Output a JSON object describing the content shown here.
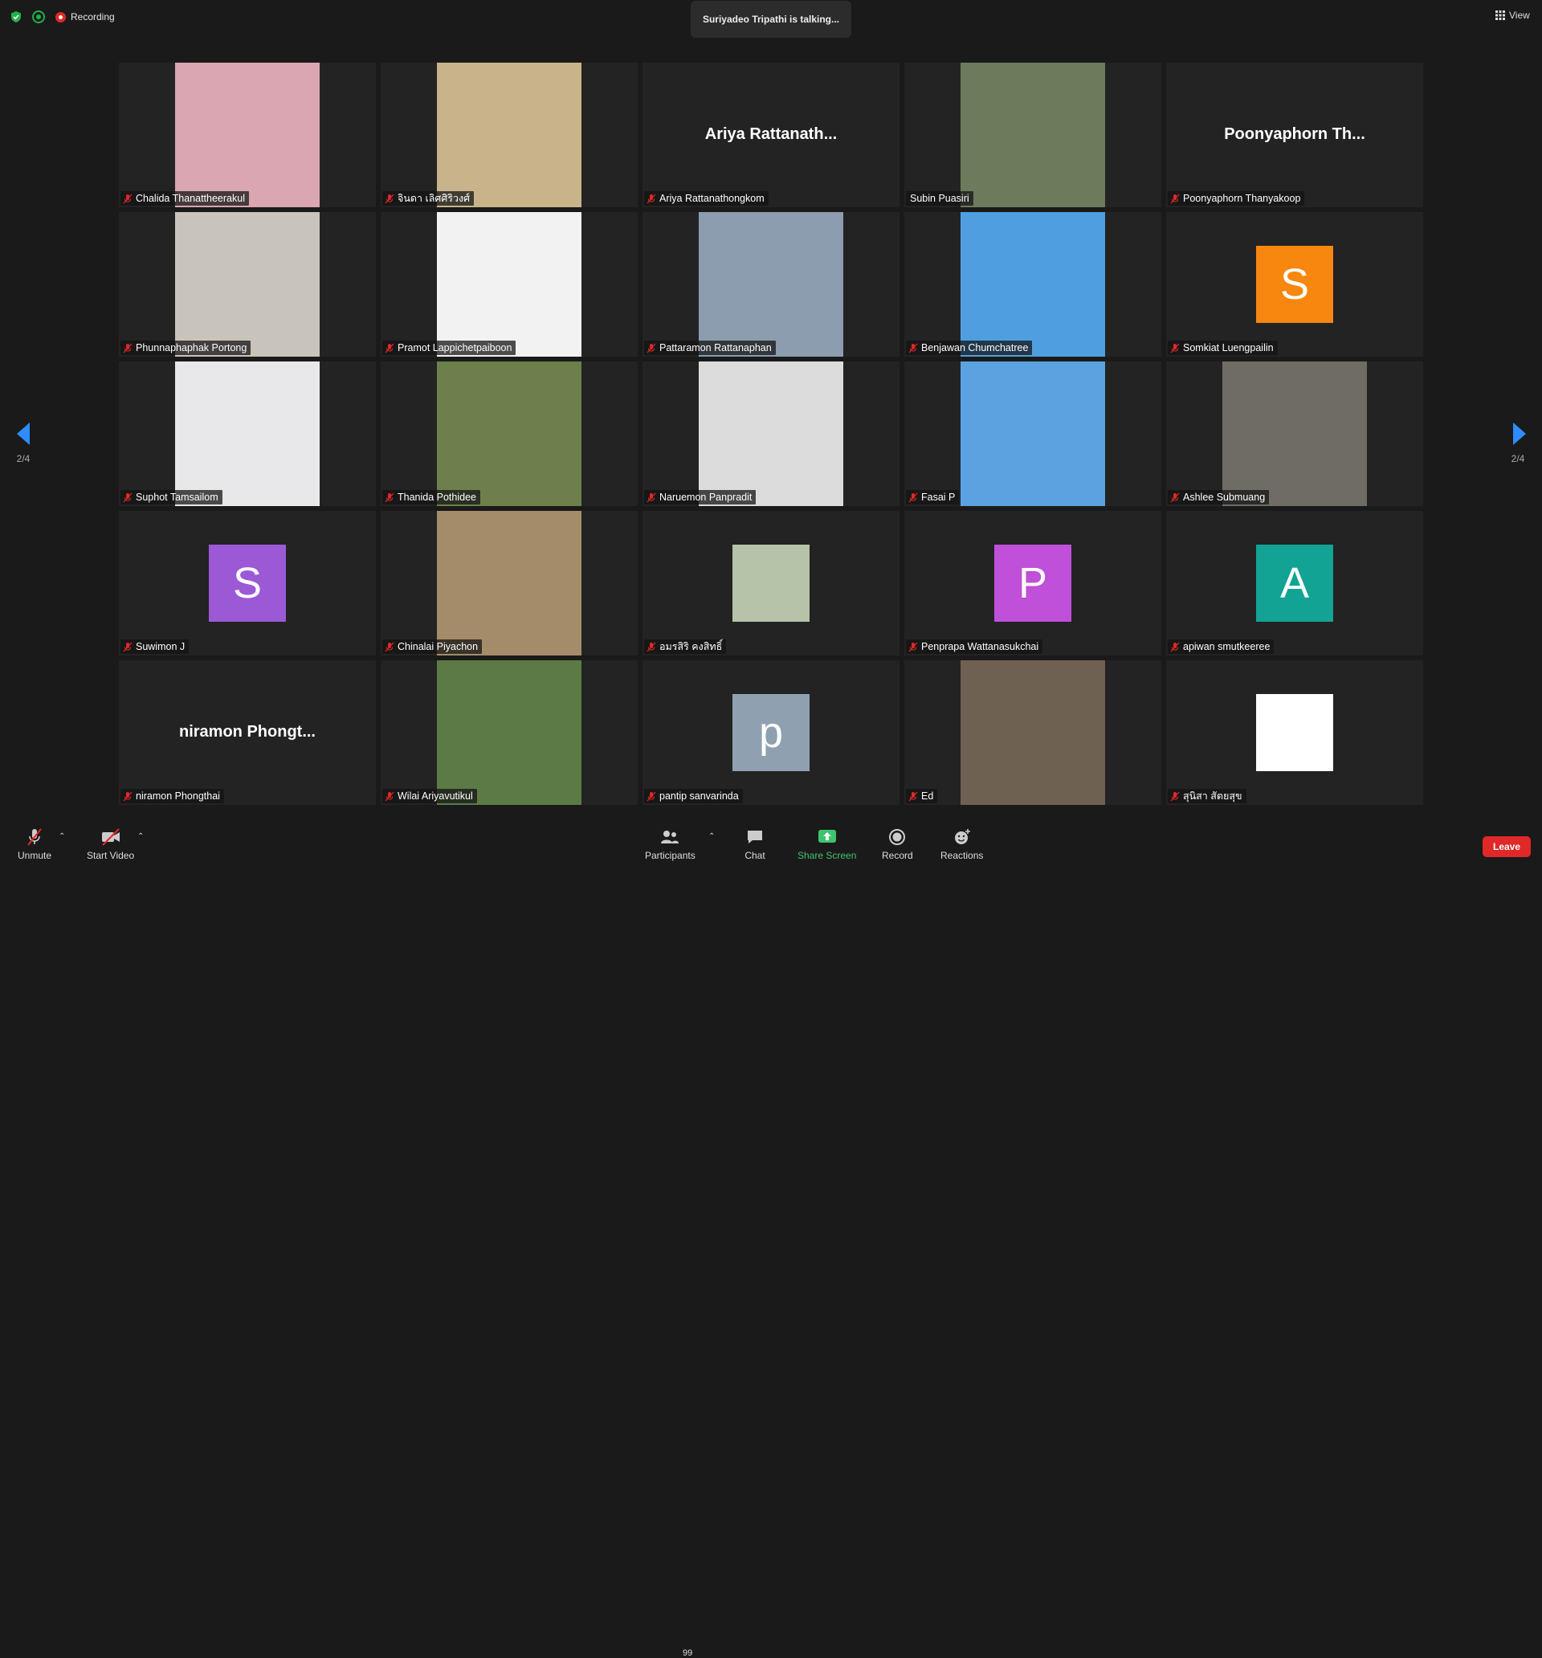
{
  "topbar": {
    "recording_label": "Recording",
    "talking": "Suriyadeo Tripathi is talking...",
    "view_label": "View"
  },
  "pagination": {
    "left": "2/4",
    "right": "2/4"
  },
  "participants": [
    {
      "name": "Chalida Thanattheerakul",
      "type": "photo",
      "color": "#d9a6b2",
      "muted": true
    },
    {
      "name": "จินดา เลิศศิริวงศ์",
      "type": "photo",
      "color": "#c8b48a",
      "muted": true
    },
    {
      "name": "Ariya Rattanathongkom",
      "type": "text",
      "display": "Ariya Rattanath...",
      "muted": true
    },
    {
      "name": "Subin Puasiri",
      "type": "photo",
      "color": "#6d7a5c",
      "muted": false
    },
    {
      "name": "Poonyaphorn Thanyakoop",
      "type": "text",
      "display": "Poonyaphorn Th...",
      "muted": true
    },
    {
      "name": "Phunnaphaphak Portong",
      "type": "photo",
      "color": "#c9c4bb",
      "muted": true
    },
    {
      "name": "Pramot Lappichetpaiboon",
      "type": "photo",
      "color": "#f2f2f2",
      "muted": true
    },
    {
      "name": "Pattaramon Rattanaphan",
      "type": "photo",
      "color": "#8d9db0",
      "muted": true
    },
    {
      "name": "Benjawan Chumchatree",
      "type": "photo",
      "color": "#4f9fe0",
      "muted": true
    },
    {
      "name": "Somkiat Luengpailin",
      "type": "letter",
      "letter": "S",
      "color": "#f7870f",
      "muted": true
    },
    {
      "name": "Suphot Tamsailom",
      "type": "photo",
      "color": "#e8e8ea",
      "muted": true
    },
    {
      "name": "Thanida Pothidee",
      "type": "photo",
      "color": "#6d7f4a",
      "muted": true
    },
    {
      "name": "Naruemon Panpradit",
      "type": "photo",
      "color": "#dcdcdc",
      "muted": true
    },
    {
      "name": "Fasai P",
      "type": "photo",
      "color": "#5aa2e0",
      "muted": true
    },
    {
      "name": "Ashlee Submuang",
      "type": "photo",
      "color": "#6f6d63",
      "muted": true
    },
    {
      "name": "Suwimon J",
      "type": "letter",
      "letter": "S",
      "color": "#9b59d6",
      "muted": true
    },
    {
      "name": "Chinalai Piyachon",
      "type": "photo",
      "color": "#a48c6a",
      "muted": true
    },
    {
      "name": "อมรสิริ คงสิทธิ์",
      "type": "photo-small",
      "color": "#b7c3a8",
      "muted": true
    },
    {
      "name": "Penprapa Wattanasukchai",
      "type": "letter",
      "letter": "P",
      "color": "#c04fd9",
      "muted": true
    },
    {
      "name": "apiwan smutkeeree",
      "type": "letter",
      "letter": "A",
      "color": "#12a395",
      "muted": true
    },
    {
      "name": "niramon Phongthai",
      "type": "text",
      "display": "niramon Phongt...",
      "muted": true
    },
    {
      "name": "Wilai Ariyavutikul",
      "type": "photo",
      "color": "#5c7a46",
      "muted": true
    },
    {
      "name": "pantip sanvarinda",
      "type": "letter",
      "letter": "p",
      "color": "#8fa1b0",
      "muted": true
    },
    {
      "name": "Ed",
      "type": "photo",
      "color": "#6e6152",
      "muted": true
    },
    {
      "name": "สุนิสา สัตยสุข",
      "type": "letter",
      "letter": "",
      "color": "#ffffff",
      "muted": true
    }
  ],
  "toolbar": {
    "unmute": "Unmute",
    "start_video": "Start Video",
    "participants": "Participants",
    "participants_count": "99",
    "chat": "Chat",
    "share_screen": "Share Screen",
    "record": "Record",
    "reactions": "Reactions",
    "leave": "Leave"
  },
  "colors": {
    "accent_green": "#3ec46d",
    "leave_red": "#e02828",
    "mute_red": "#e02828"
  }
}
